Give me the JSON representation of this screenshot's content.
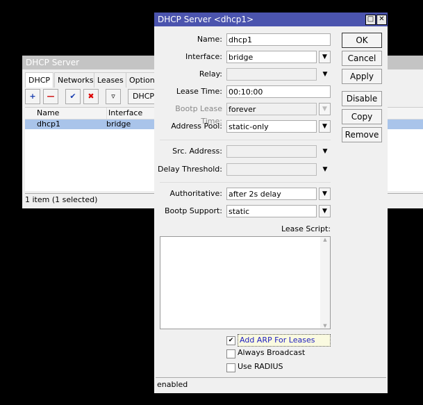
{
  "bg_window": {
    "title": "DHCP Server",
    "tabs": [
      "DHCP",
      "Networks",
      "Leases",
      "Options",
      "DHCP"
    ],
    "columns": [
      "Name",
      "Interface"
    ],
    "rows": [
      {
        "name": "dhcp1",
        "interface": "bridge"
      }
    ],
    "status": "1 item (1 selected)"
  },
  "dialog": {
    "title": "DHCP Server <dhcp1>",
    "fields": {
      "name": {
        "label": "Name:",
        "value": "dhcp1"
      },
      "interface": {
        "label": "Interface:",
        "value": "bridge"
      },
      "relay": {
        "label": "Relay:",
        "value": ""
      },
      "lease_time": {
        "label": "Lease Time:",
        "value": "00:10:00"
      },
      "bootp_lease_time": {
        "label": "Bootp Lease Time:",
        "value": "forever"
      },
      "address_pool": {
        "label": "Address Pool:",
        "value": "static-only"
      },
      "src_address": {
        "label": "Src. Address:",
        "value": ""
      },
      "delay_threshold": {
        "label": "Delay Threshold:",
        "value": ""
      },
      "authoritative": {
        "label": "Authoritative:",
        "value": "after 2s delay"
      },
      "bootp_support": {
        "label": "Bootp Support:",
        "value": "static"
      },
      "lease_script": {
        "label": "Lease Script:",
        "value": ""
      }
    },
    "checkboxes": [
      {
        "label": "Add ARP For Leases",
        "checked": true
      },
      {
        "label": "Always Broadcast",
        "checked": false
      },
      {
        "label": "Use RADIUS",
        "checked": false
      }
    ],
    "buttons": {
      "ok": "OK",
      "cancel": "Cancel",
      "apply": "Apply",
      "disable": "Disable",
      "copy": "Copy",
      "remove": "Remove"
    },
    "status": "enabled"
  }
}
